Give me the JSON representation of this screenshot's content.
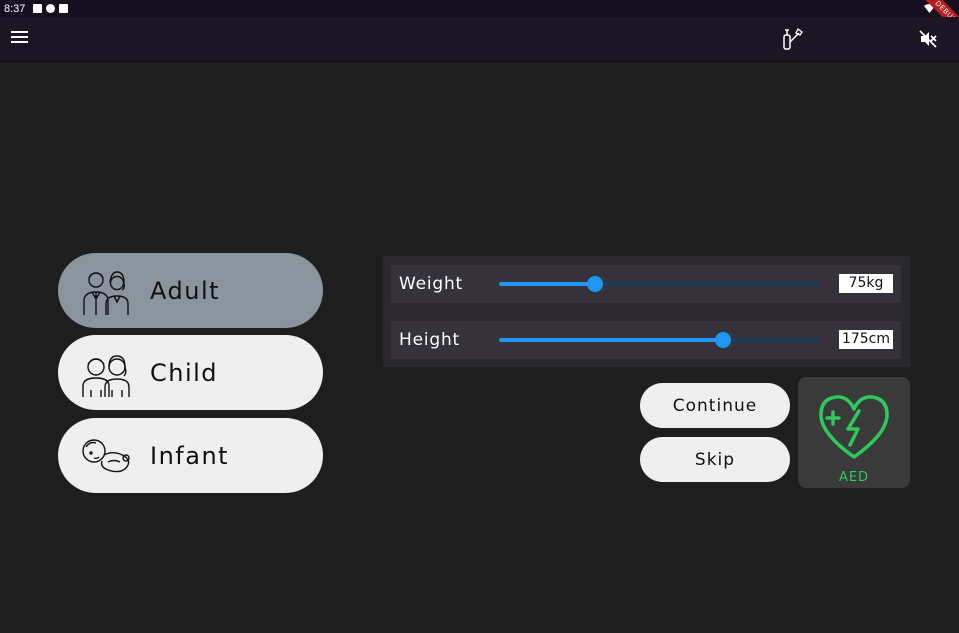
{
  "status_bar": {
    "time": "8:37",
    "debug_label": "DEBUG"
  },
  "app_bar": {
    "menu_icon": "hamburger-menu-icon",
    "tool_icon": "bag-valve-icon",
    "mute_icon": "volume-off-icon"
  },
  "patient_types": [
    {
      "label": "Adult",
      "icon": "adult-couple-icon",
      "selected": true
    },
    {
      "label": "Child",
      "icon": "children-icon",
      "selected": false
    },
    {
      "label": "Infant",
      "icon": "infant-icon",
      "selected": false
    }
  ],
  "sliders": {
    "weight": {
      "label": "Weight",
      "value_text": "75kg",
      "level": 0.3
    },
    "height": {
      "label": "Height",
      "value_text": "175cm",
      "level": 0.7
    }
  },
  "actions": {
    "continue_label": "Continue",
    "skip_label": "Skip"
  },
  "aed": {
    "label": "AED",
    "icon": "heart-defibrillator-icon",
    "color": "#2ec95a"
  },
  "colors": {
    "background": "#1e1e1e",
    "app_bar": "#1c1526",
    "selected_pill": "#8a949e",
    "slider_accent": "#2196f3"
  }
}
